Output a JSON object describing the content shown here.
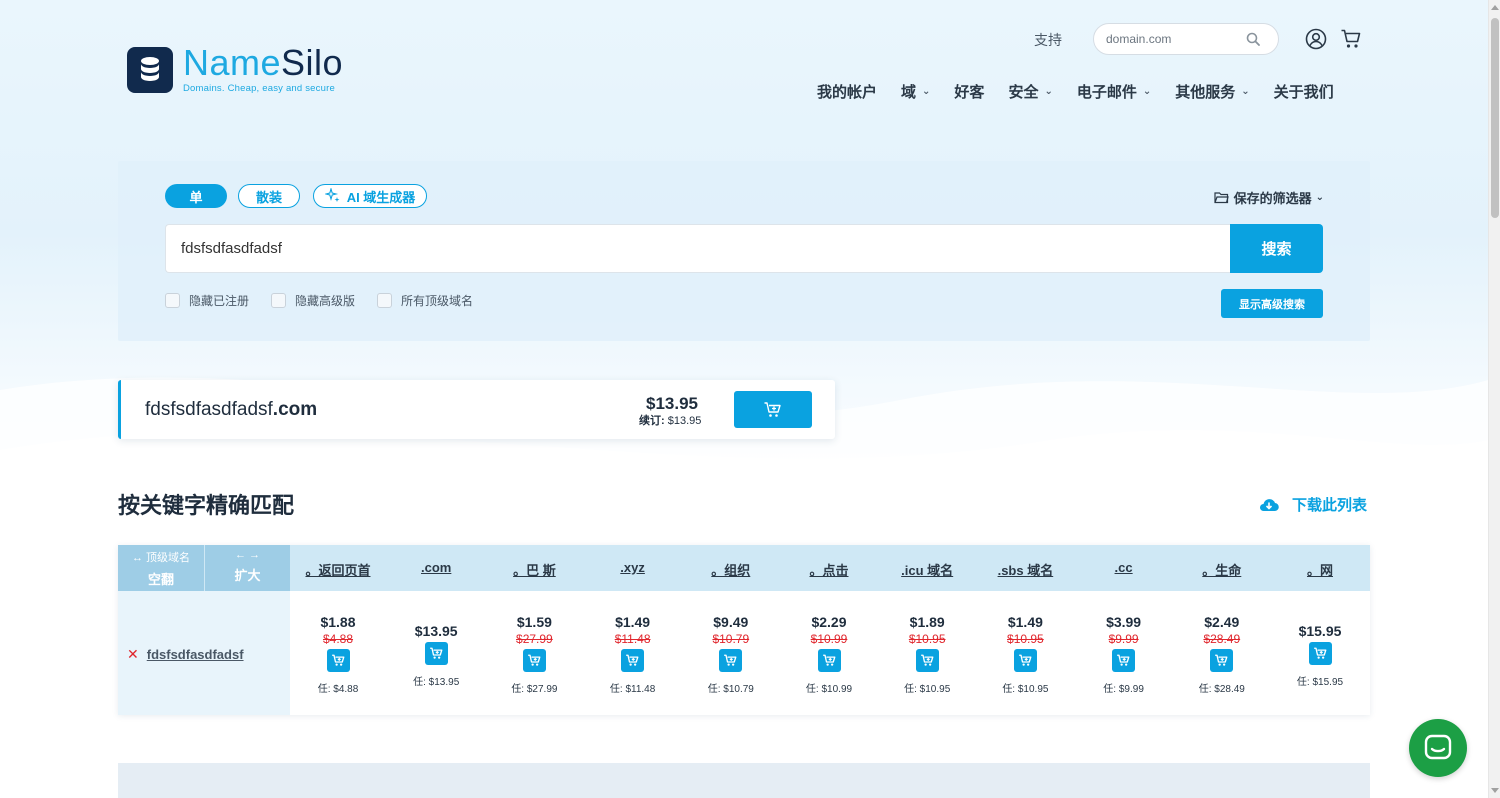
{
  "header": {
    "brand_part1": "Name",
    "brand_part2": "Silo",
    "tagline": "Domains. Cheap, easy and secure",
    "support_label": "支持",
    "search_placeholder": "domain.com",
    "icons": [
      "search-icon",
      "user-icon",
      "cart-icon"
    ]
  },
  "nav": [
    {
      "label": "我的帐户",
      "dropdown": false
    },
    {
      "label": "域",
      "dropdown": true
    },
    {
      "label": "好客",
      "dropdown": false
    },
    {
      "label": "安全",
      "dropdown": true
    },
    {
      "label": "电子邮件",
      "dropdown": true
    },
    {
      "label": "其他服务",
      "dropdown": true
    },
    {
      "label": "关于我们",
      "dropdown": false
    }
  ],
  "search_panel": {
    "modes": [
      "单",
      "散装",
      "AI 域生成器"
    ],
    "active_mode": "单",
    "saved_filters": "保存的筛选器",
    "query": "fdsfsdfasdfadsf",
    "search_button": "搜索",
    "checkboxes": [
      "隐藏已注册",
      "隐藏高级版",
      "所有顶级域名"
    ],
    "advanced_button": "显示高级搜索"
  },
  "result": {
    "name": "fdsfsdfasdfadsf",
    "tld": ".com",
    "price": "$13.95",
    "renew_label": "续订:",
    "renew_price": "$13.95"
  },
  "section": {
    "title": "按关键字精确匹配",
    "download": "下载此列表"
  },
  "table": {
    "ctrl_a_line1": "↔ 顶级域名",
    "ctrl_a_line2": "空翻",
    "ctrl_b_line1": "← →",
    "ctrl_b_line2": "扩大",
    "row_name": "fdsfsdfasdfadsf",
    "row_status": "✕",
    "renew_prefix": "任:",
    "tlds": [
      {
        "label": "。返回页首",
        "price": "$1.88",
        "old": "$4.88",
        "renew": "$4.88"
      },
      {
        "label": ".com",
        "price": "$13.95",
        "old": "",
        "renew": "$13.95"
      },
      {
        "label": "。巴 斯",
        "price": "$1.59",
        "old": "$27.99",
        "renew": "$27.99"
      },
      {
        "label": ".xyz",
        "price": "$1.49",
        "old": "$11.48",
        "renew": "$11.48"
      },
      {
        "label": "。组织",
        "price": "$9.49",
        "old": "$10.79",
        "renew": "$10.79"
      },
      {
        "label": "。点击",
        "price": "$2.29",
        "old": "$10.99",
        "renew": "$10.99"
      },
      {
        "label": ".icu 域名",
        "price": "$1.89",
        "old": "$10.95",
        "renew": "$10.95"
      },
      {
        "label": ".sbs 域名",
        "price": "$1.49",
        "old": "$10.95",
        "renew": "$10.95"
      },
      {
        "label": ".cc",
        "price": "$3.99",
        "old": "$9.99",
        "renew": "$9.99"
      },
      {
        "label": "。生命",
        "price": "$2.49",
        "old": "$28.49",
        "renew": "$28.49"
      },
      {
        "label": "。网",
        "price": "$15.95",
        "old": "",
        "renew": "$15.95"
      }
    ]
  },
  "colors": {
    "accent": "#0aa2e0",
    "navy": "#112a4d",
    "strike": "#e0262d",
    "chat": "#1c9f45"
  }
}
